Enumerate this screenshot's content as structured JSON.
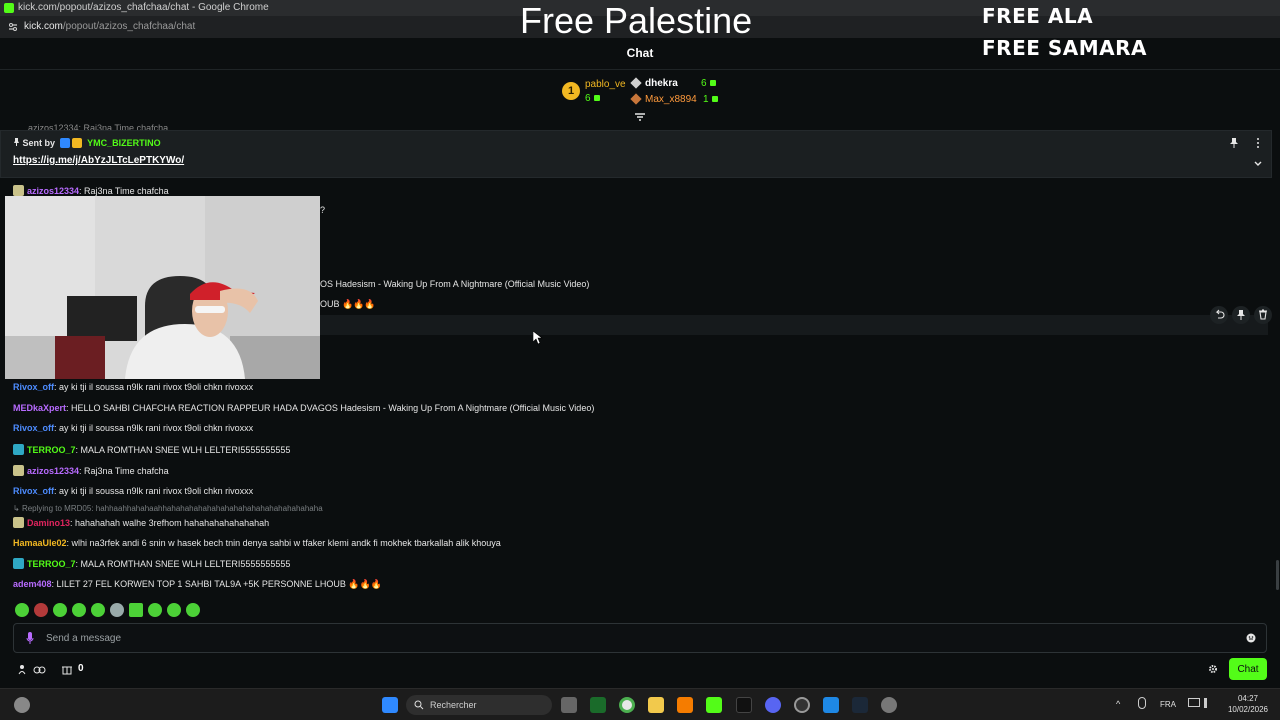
{
  "browser": {
    "title": "kick.com/popout/azizos_chafchaa/chat - Google Chrome",
    "url_host": "kick.com",
    "url_path": "/popout/azizos_chafchaa/chat"
  },
  "overlays": {
    "free_palestine": "Free Palestine",
    "free_ala": "FREE ALA",
    "free_samara": "FREE SAMARA"
  },
  "chat": {
    "title": "Chat",
    "leaderboard": [
      {
        "rank": "1",
        "name": "pablo_ve",
        "count": "6",
        "color": "#f2b822"
      },
      {
        "name": "dhekra",
        "count": "6",
        "color": "#ffffff"
      },
      {
        "name": "Max_x8894",
        "count": "1",
        "color": "#ff9a3c"
      }
    ],
    "cut_line": "azizos12334: Raj3na Time chafcha",
    "pinned": {
      "sent_by": "Sent by",
      "sender": "YMC_BIZERTINO",
      "link": "https://ig.me/j/AbYzJLTcLePTKYWo/"
    },
    "partial": {
      "p1": "?",
      "p2": "OS Hadesism - Waking Up From A Nightmare (Official Music Video)",
      "p3": "OUB 🔥🔥🔥"
    },
    "messages": [
      {
        "user": "azizos12334",
        "text": ": Raj3na Time chafcha",
        "color": "#b86bff"
      },
      {
        "user": "Rivox_off",
        "text": ": ay ki tji il soussa n9lk rani rivox t9oli chkn rivoxxx",
        "color": "#4d8cff"
      },
      {
        "user": "MEDkaXpert",
        "text": ": HELLO SAHBI CHAFCHA REACTION RAPPEUR HADA DVAGOS Hadesism - Waking Up From A Nightmare (Official Music Video)",
        "color": "#b86bff"
      },
      {
        "user": "Rivox_off",
        "text": ": ay ki tji il soussa n9lk rani rivox t9oli chkn rivoxxx",
        "color": "#4d8cff"
      },
      {
        "user": "TERROO_7",
        "text": ": MALA ROMTHAN SNEE WLH LELTERI5555555555",
        "color": "#53fc18"
      },
      {
        "user": "azizos12334",
        "text": ": Raj3na Time chafcha",
        "color": "#b86bff"
      },
      {
        "user": "Rivox_off",
        "text": ": ay ki tji il soussa n9lk rani rivox t9oli chkn rivoxxx",
        "color": "#4d8cff"
      },
      {
        "user": "Damino13",
        "text": ": hahahahah walhe 3refhom hahahahahahahahah",
        "color": "#e0245e"
      },
      {
        "user": "HamaaUle02",
        "text": ": wlhi na3rfek andi 6 snin w hasek bech tnin denya sahbi w tfaker klemi andk fi mokhek tbarkallah alik khouya",
        "color": "#f2b822"
      },
      {
        "user": "TERROO_7",
        "text": ": MALA ROMTHAN SNEE WLH LELTERI5555555555",
        "color": "#53fc18"
      },
      {
        "user": "adem408",
        "text": ": LILET 27 FEL KORWEN TOP 1 SAHBI TAL9A +5K PERSONNE LHOUB 🔥🔥🔥",
        "color": "#b86bff"
      }
    ],
    "reply_to": "Replying to MRD05: hahhaahhahahaahhahahahahahahahahahahahahahahahahaha",
    "input_placeholder": "Send a message",
    "gift_count": "0",
    "send_label": "Chat"
  },
  "taskbar": {
    "search_label": "Rechercher",
    "language": "FRA",
    "time": "04:27",
    "date": "10/02/2026"
  }
}
